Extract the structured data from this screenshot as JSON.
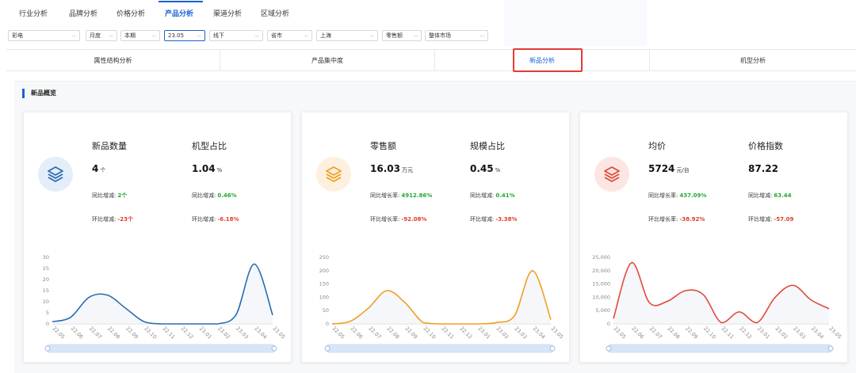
{
  "nav": {
    "tabs": [
      {
        "label": "行业分析"
      },
      {
        "label": "品牌分析"
      },
      {
        "label": "价格分析"
      },
      {
        "label": "产品分析"
      },
      {
        "label": "渠道分析"
      },
      {
        "label": "区域分析"
      }
    ],
    "active": "产品分析"
  },
  "filters": {
    "category": "彩电",
    "period_type": "月度",
    "period": "本期",
    "month": "23.05",
    "channel": "线下",
    "region_level": "省市",
    "region": "上海",
    "metric": "零售额",
    "market": "整体市场"
  },
  "subtabs": [
    {
      "label": "属性结构分析"
    },
    {
      "label": "产品集中度"
    },
    {
      "label": "新品分析"
    },
    {
      "label": "机型分析"
    }
  ],
  "section": {
    "title": "新品概览"
  },
  "cards": [
    {
      "color": "#2b6cb0",
      "icon_bg": "#e4eef9",
      "icon": "layers-icon",
      "left": {
        "title": "新品数量",
        "value": "4",
        "unit": "个",
        "yoy_label": "同比增减:",
        "yoy": "2个",
        "mom_label": "环比增减:",
        "mom": "-23个"
      },
      "right": {
        "title": "机型占比",
        "value": "1.04",
        "unit": "%",
        "yoy_label": "同比增减:",
        "yoy": "0.46%",
        "mom_label": "环比增减:",
        "mom": "-6.18%"
      }
    },
    {
      "color": "#f0a020",
      "icon_bg": "#fdf0de",
      "icon": "layers-icon",
      "left": {
        "title": "零售额",
        "value": "16.03",
        "unit": "万元",
        "yoy_label": "同比增长率:",
        "yoy": "4912.86%",
        "mom_label": "环比增长率:",
        "mom": "-92.08%"
      },
      "right": {
        "title": "规模占比",
        "value": "0.45",
        "unit": "%",
        "yoy_label": "同比增减:",
        "yoy": "0.41%",
        "mom_label": "环比增减:",
        "mom": "-3.38%"
      }
    },
    {
      "color": "#e04a3a",
      "icon_bg": "#fce6e3",
      "icon": "layers-icon",
      "left": {
        "title": "均价",
        "value": "5724",
        "unit": "元/台",
        "yoy_label": "同比增长率:",
        "yoy": "437.09%",
        "mom_label": "环比增长率:",
        "mom": "-38.92%"
      },
      "right": {
        "title": "价格指数",
        "value": "87.22",
        "unit": "",
        "yoy_label": "同比增减:",
        "yoy": "63.44",
        "mom_label": "环比增减:",
        "mom": "-57.09"
      }
    }
  ],
  "chart_data": [
    {
      "type": "line",
      "categories": [
        "22.05",
        "22.06",
        "22.07",
        "22.08",
        "22.09",
        "22.10",
        "22.11",
        "22.12",
        "23.01",
        "23.02",
        "23.03",
        "23.04",
        "23.05"
      ],
      "series": [
        {
          "values": [
            1,
            3,
            12,
            13,
            7,
            1,
            0,
            0,
            0,
            0,
            4,
            27,
            4
          ]
        }
      ],
      "ylim": [
        0,
        30
      ],
      "yticks": [
        "0",
        "5",
        "10",
        "15",
        "20",
        "25",
        "30"
      ],
      "color": "#2b6cb0"
    },
    {
      "type": "line",
      "categories": [
        "22.05",
        "22.06",
        "22.07",
        "22.08",
        "22.09",
        "22.10",
        "22.11",
        "22.12",
        "23.01",
        "23.02",
        "23.03",
        "23.04",
        "23.05"
      ],
      "series": [
        {
          "values": [
            0,
            10,
            60,
            125,
            80,
            5,
            0,
            0,
            0,
            5,
            30,
            200,
            16
          ]
        }
      ],
      "ylim": [
        0,
        250
      ],
      "yticks": [
        "0",
        "50",
        "100",
        "150",
        "200",
        "250"
      ],
      "color": "#f0a020"
    },
    {
      "type": "line",
      "categories": [
        "22.05",
        "22.06",
        "22.07",
        "22.08",
        "22.09",
        "22.10",
        "22.11",
        "22.12",
        "23.01",
        "23.02",
        "23.03",
        "23.04",
        "23.05"
      ],
      "series": [
        {
          "values": [
            2000,
            23000,
            8000,
            8500,
            12500,
            11000,
            500,
            4500,
            500,
            10000,
            14500,
            9000,
            5700
          ]
        }
      ],
      "ylim": [
        0,
        25000
      ],
      "yticks": [
        "0",
        "5,000",
        "10,000",
        "15,000",
        "20,000",
        "25,000"
      ],
      "color": "#e04a3a"
    }
  ]
}
